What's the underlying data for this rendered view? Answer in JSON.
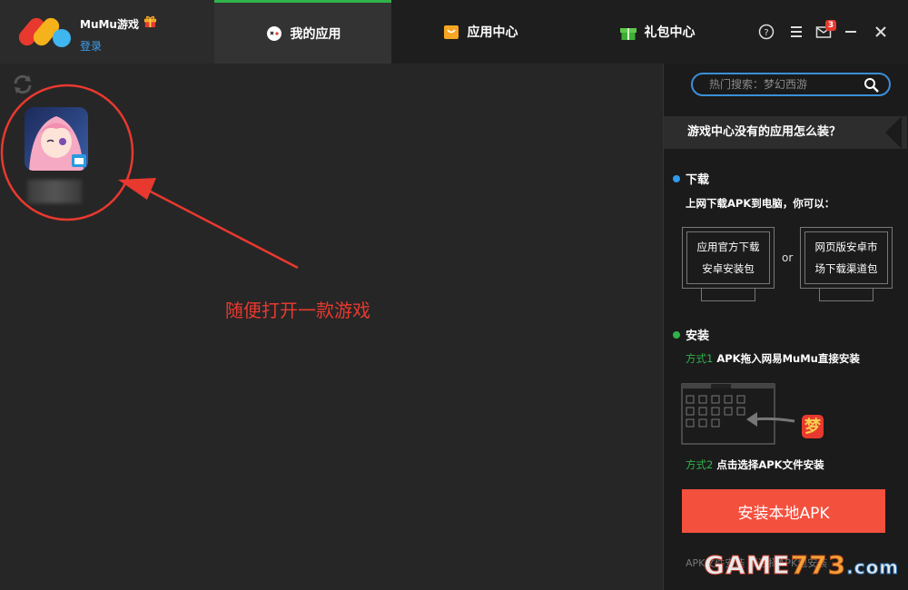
{
  "app": {
    "name": "MuMu游戏",
    "login": "登录"
  },
  "tabs": [
    {
      "label": "我的应用",
      "active": true
    },
    {
      "label": "应用中心",
      "active": false
    },
    {
      "label": "礼包中心",
      "active": false
    }
  ],
  "window_controls": {
    "mail_badge": "3"
  },
  "annotation": {
    "text": "随便打开一款游戏"
  },
  "right_panel": {
    "search_placeholder": "热门搜索：梦幻西游",
    "faq_title": "游戏中心没有的应用怎么装？",
    "download": {
      "title": "下载",
      "desc": "上网下载APK到电脑，你可以：",
      "option1_line1": "应用官方下载",
      "option1_line2": "安卓安装包",
      "or": "or",
      "option2_line1": "网页版安卓市",
      "option2_line2": "场下载渠道包"
    },
    "install": {
      "title": "安装",
      "method1_prefix": "方式1",
      "method1_text": " APK拖入网易MuMu直接安装",
      "method2_prefix": "方式2",
      "method2_text": " 点击选择APK文件安装",
      "button": "安装本地APK",
      "hint": "APK文件安装 请选择APK包安装"
    }
  },
  "watermark": {
    "part1": "GAME",
    "part2": "773",
    "part3": ".com"
  },
  "colors": {
    "accent_green": "#2fb34a",
    "accent_blue": "#3a8fd8",
    "install_button": "#f4503e",
    "annotation_red": "#e8392f"
  }
}
